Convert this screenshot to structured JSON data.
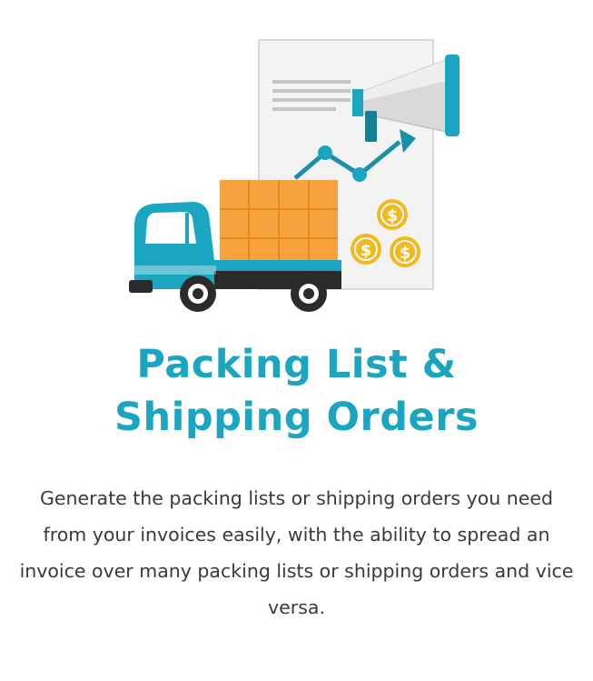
{
  "colors": {
    "accent": "#1aa6c0",
    "text": "#3a3a3a",
    "box": "#f7a23e",
    "coin": "#f5b81b"
  },
  "icons": {
    "main": "truck-document-megaphone-illustration"
  },
  "feature": {
    "title_line1": "Packing List &",
    "title_line2": "Shipping Orders",
    "description": "Generate the packing lists or shipping orders you need from your invoices easily, with the ability to spread an invoice over many packing lists or shipping orders and vice versa."
  }
}
